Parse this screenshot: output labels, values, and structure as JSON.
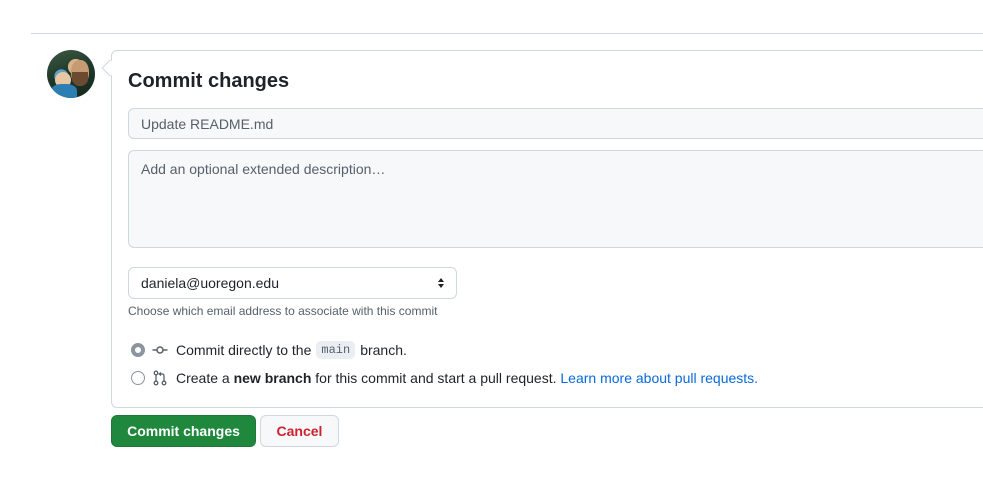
{
  "form": {
    "title": "Commit changes",
    "summary_placeholder": "Update README.md",
    "description_placeholder": "Add an optional extended description…",
    "email_value": "daniela@uoregon.edu",
    "email_hint": "Choose which email address to associate with this commit"
  },
  "options": {
    "direct": {
      "prefix": "Commit directly to the",
      "branch": "main",
      "suffix": "branch.",
      "selected": true
    },
    "new_branch": {
      "prefix": "Create a",
      "bold": "new branch",
      "middle": "for this commit and start a pull request.",
      "link": "Learn more about pull requests.",
      "selected": false
    }
  },
  "buttons": {
    "commit_label": "Commit changes",
    "cancel_label": "Cancel"
  },
  "colors": {
    "primary": "#1f883d",
    "danger": "#cf222e",
    "link": "#0969da"
  }
}
